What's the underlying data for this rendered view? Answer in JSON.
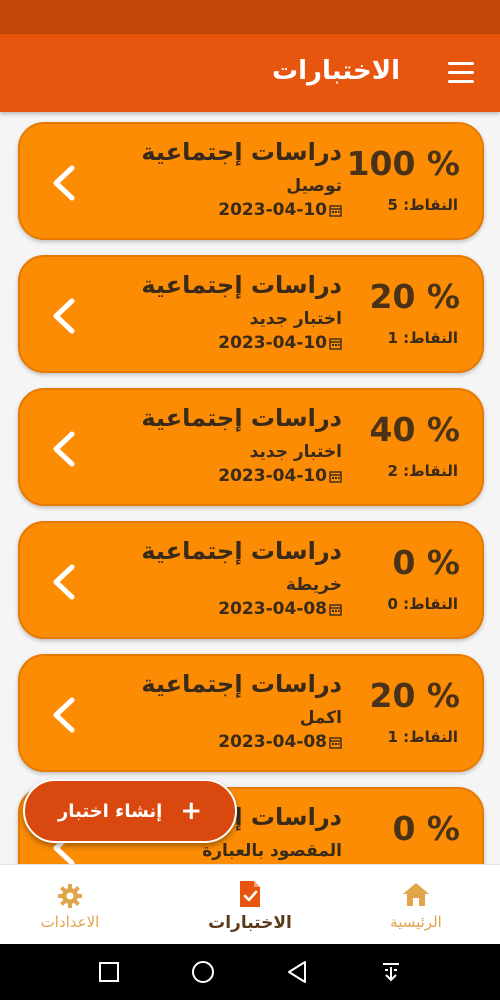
{
  "app_bar": {
    "title": "الاختبارات"
  },
  "quizzes": [
    {
      "title": "دراسات إجتماعية",
      "subtitle": "توصيل",
      "date": "2023-04-10",
      "percent": "100 %",
      "points": "النقاط: 5"
    },
    {
      "title": "دراسات إجتماعية",
      "subtitle": "اختبار جديد",
      "date": "2023-04-10",
      "percent": "20 %",
      "points": "النقاط: 1"
    },
    {
      "title": "دراسات إجتماعية",
      "subtitle": "اختبار جديد",
      "date": "2023-04-10",
      "percent": "40 %",
      "points": "النقاط: 2"
    },
    {
      "title": "دراسات إجتماعية",
      "subtitle": "خريطة",
      "date": "2023-04-08",
      "percent": "0 %",
      "points": "النقاط: 0"
    },
    {
      "title": "دراسات إجتماعية",
      "subtitle": "اكمل",
      "date": "2023-04-08",
      "percent": "20 %",
      "points": "النقاط: 1"
    },
    {
      "title": "دراسات إجتماعية",
      "subtitle": "المقصود بالعبارة",
      "date": "",
      "percent": "0 %",
      "points": ""
    }
  ],
  "fab": {
    "label": "إنشاء اختبار",
    "icon": "plus-icon"
  },
  "bottom_nav": {
    "home": {
      "label": "الرئيسية",
      "icon": "home-icon"
    },
    "quizzes": {
      "label": "الاختبارات",
      "icon": "document-check-icon"
    },
    "settings": {
      "label": "الاعدادات",
      "icon": "gear-icon"
    }
  },
  "colors": {
    "app_bar": "#e8550f",
    "status_bar": "#c44808",
    "card": "#fb8c04",
    "fab": "#d9480f",
    "nav_inactive": "#e0a44a",
    "nav_active": "#5a3a1a"
  }
}
